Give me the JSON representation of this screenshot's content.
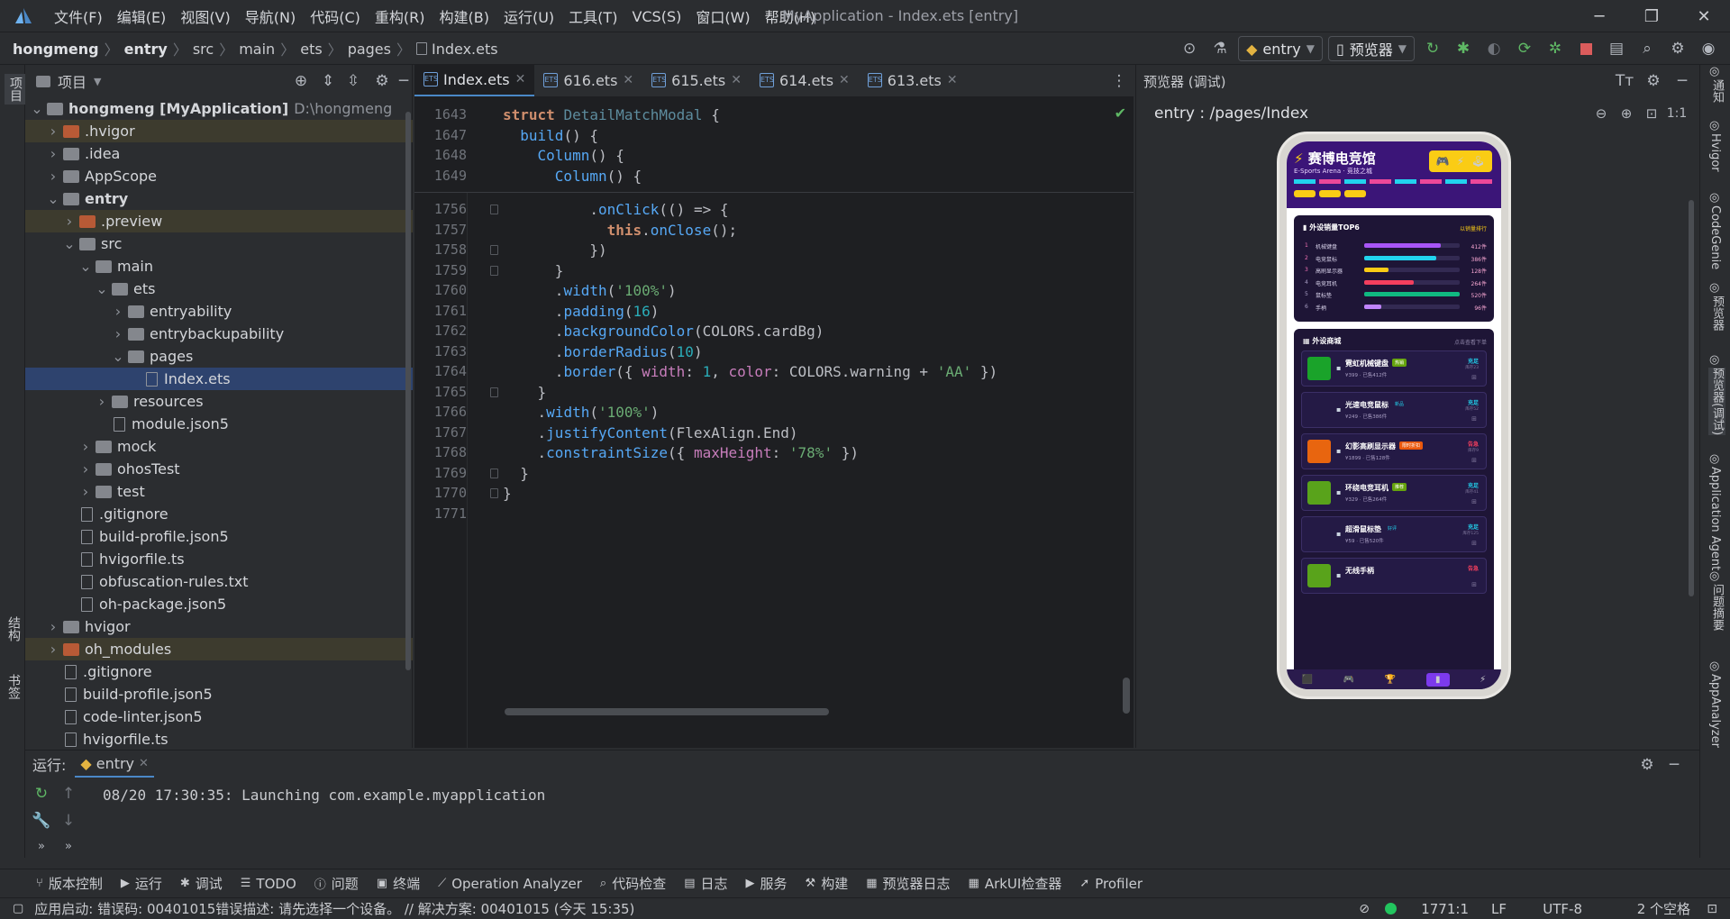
{
  "app": {
    "window_title": "MyApplication - Index.ets [entry]"
  },
  "menu": [
    "文件(F)",
    "编辑(E)",
    "视图(V)",
    "导航(N)",
    "代码(C)",
    "重构(R)",
    "构建(B)",
    "运行(U)",
    "工具(T)",
    "VCS(S)",
    "窗口(W)",
    "帮助(H)"
  ],
  "breadcrumb": [
    "hongmeng",
    "entry",
    "src",
    "main",
    "ets",
    "pages",
    "Index.ets"
  ],
  "toolbar": {
    "run_config": "entry",
    "device": "预览器"
  },
  "project": {
    "title": "项目",
    "tree": [
      {
        "label": "hongmeng [MyApplication]",
        "extra": "D:\\hongmeng",
        "indent": 0,
        "arrow": "v",
        "icon": "fold",
        "bold": true
      },
      {
        "label": ".hvigor",
        "indent": 1,
        "arrow": ">",
        "icon": "ofold",
        "hl": true
      },
      {
        "label": ".idea",
        "indent": 1,
        "arrow": ">",
        "icon": "fold"
      },
      {
        "label": "AppScope",
        "indent": 1,
        "arrow": ">",
        "icon": "fold"
      },
      {
        "label": "entry",
        "indent": 1,
        "arrow": "v",
        "icon": "fold",
        "bold": true
      },
      {
        "label": ".preview",
        "indent": 2,
        "arrow": ">",
        "icon": "ofold",
        "hl": true
      },
      {
        "label": "src",
        "indent": 2,
        "arrow": "v",
        "icon": "fold"
      },
      {
        "label": "main",
        "indent": 3,
        "arrow": "v",
        "icon": "fold"
      },
      {
        "label": "ets",
        "indent": 4,
        "arrow": "v",
        "icon": "fold"
      },
      {
        "label": "entryability",
        "indent": 5,
        "arrow": ">",
        "icon": "fold"
      },
      {
        "label": "entrybackupability",
        "indent": 5,
        "arrow": ">",
        "icon": "fold"
      },
      {
        "label": "pages",
        "indent": 5,
        "arrow": "v",
        "icon": "fold"
      },
      {
        "label": "Index.ets",
        "indent": 6,
        "arrow": "",
        "icon": "file",
        "sel": true
      },
      {
        "label": "resources",
        "indent": 4,
        "arrow": ">",
        "icon": "fold"
      },
      {
        "label": "module.json5",
        "indent": 4,
        "arrow": "",
        "icon": "file"
      },
      {
        "label": "mock",
        "indent": 3,
        "arrow": ">",
        "icon": "fold"
      },
      {
        "label": "ohosTest",
        "indent": 3,
        "arrow": ">",
        "icon": "fold"
      },
      {
        "label": "test",
        "indent": 3,
        "arrow": ">",
        "icon": "fold"
      },
      {
        "label": ".gitignore",
        "indent": 2,
        "arrow": "",
        "icon": "file"
      },
      {
        "label": "build-profile.json5",
        "indent": 2,
        "arrow": "",
        "icon": "file"
      },
      {
        "label": "hvigorfile.ts",
        "indent": 2,
        "arrow": "",
        "icon": "file"
      },
      {
        "label": "obfuscation-rules.txt",
        "indent": 2,
        "arrow": "",
        "icon": "file"
      },
      {
        "label": "oh-package.json5",
        "indent": 2,
        "arrow": "",
        "icon": "file"
      },
      {
        "label": "hvigor",
        "indent": 1,
        "arrow": ">",
        "icon": "fold"
      },
      {
        "label": "oh_modules",
        "indent": 1,
        "arrow": ">",
        "icon": "ofold",
        "hl": true
      },
      {
        "label": ".gitignore",
        "indent": 1,
        "arrow": "",
        "icon": "file"
      },
      {
        "label": "build-profile.json5",
        "indent": 1,
        "arrow": "",
        "icon": "file"
      },
      {
        "label": "code-linter.json5",
        "indent": 1,
        "arrow": "",
        "icon": "file"
      },
      {
        "label": "hvigorfile.ts",
        "indent": 1,
        "arrow": "",
        "icon": "file"
      }
    ]
  },
  "tabs": [
    "Index.ets",
    "616.ets",
    "615.ets",
    "614.ets",
    "613.ets"
  ],
  "code": {
    "sticky": [
      {
        "n": "1643",
        "t": "struct DetailMatchModal {"
      },
      {
        "n": "1647",
        "t": "  build() {"
      },
      {
        "n": "1648",
        "t": "    Column() {"
      },
      {
        "n": "1649",
        "t": "      Column() {"
      }
    ],
    "lines": [
      {
        "n": "1756",
        "t": "          .onClick(() => {"
      },
      {
        "n": "1757",
        "t": "            this.onClose();"
      },
      {
        "n": "1758",
        "t": "          })"
      },
      {
        "n": "1759",
        "t": "      }"
      },
      {
        "n": "1760",
        "t": "      .width('100%')"
      },
      {
        "n": "1761",
        "t": "      .padding(16)"
      },
      {
        "n": "1762",
        "t": "      .backgroundColor(COLORS.cardBg)"
      },
      {
        "n": "1763",
        "t": "      .borderRadius(10)"
      },
      {
        "n": "1764",
        "t": "      .border({ width: 1, color: COLORS.warning + 'AA' })"
      },
      {
        "n": "1765",
        "t": "    }"
      },
      {
        "n": "1766",
        "t": "    .width('100%')"
      },
      {
        "n": "1767",
        "t": "    .justifyContent(FlexAlign.End)"
      },
      {
        "n": "1768",
        "t": "    .constraintSize({ maxHeight: '78%' })"
      },
      {
        "n": "1769",
        "t": "  }"
      },
      {
        "n": "1770",
        "t": "}"
      },
      {
        "n": "1771",
        "t": ""
      }
    ]
  },
  "preview": {
    "title": "预览器 (调试)",
    "path": "entry : /pages/Index",
    "app": {
      "header_title": "赛博电竞馆",
      "header_sub": "E-Sports Arena · 竞技之城",
      "top_card": {
        "title": "外设销量TOP6",
        "right": "以销量排行",
        "rows": [
          {
            "rank": "1",
            "name": "机械键盘",
            "value": "412件",
            "pct": 0.8,
            "color": "#a855f7"
          },
          {
            "rank": "2",
            "name": "电竞鼠标",
            "value": "386件",
            "pct": 0.75,
            "color": "#22d3ee"
          },
          {
            "rank": "3",
            "name": "高刷显示器",
            "value": "128件",
            "pct": 0.25,
            "color": "#facc15"
          },
          {
            "rank": "4",
            "name": "电竞耳机",
            "value": "264件",
            "pct": 0.52,
            "color": "#f43f5e"
          },
          {
            "rank": "5",
            "name": "鼠标垫",
            "value": "520件",
            "pct": 1.0,
            "color": "#10b981"
          },
          {
            "rank": "6",
            "name": "手柄",
            "value": "96件",
            "pct": 0.18,
            "color": "#c084fc"
          }
        ]
      },
      "shop_card": {
        "title": "外设商城",
        "right": "点击查看下单",
        "items": [
          {
            "name": "霓虹机械键盘",
            "tag": "热销",
            "price": "¥399 · 已售412件",
            "status": "充足",
            "stock": "库存23",
            "thumb": "#1aa32a",
            "tagc": "#65a30d",
            "sc": "#22d3ee"
          },
          {
            "name": "光速电竞鼠标",
            "tag": "新品",
            "price": "¥249 · 已售386件",
            "status": "充足",
            "stock": "库存52",
            "thumb": "",
            "tagc": "",
            "sc": "#22d3ee"
          },
          {
            "name": "幻影高刷显示器",
            "tag": "限时折扣",
            "price": "¥1899 · 已售128件",
            "status": "告急",
            "stock": "库存9",
            "thumb": "#e8650f",
            "tagc": "#ea580c",
            "sc": "#f43f5e"
          },
          {
            "name": "环绕电竞耳机",
            "tag": "推荐",
            "price": "¥329 · 已售264件",
            "status": "充足",
            "stock": "库存41",
            "thumb": "#59a31b",
            "tagc": "#65a30d",
            "sc": "#22d3ee"
          },
          {
            "name": "超滑鼠标垫",
            "tag": "好评",
            "price": "¥59 · 已售520件",
            "status": "充足",
            "stock": "库存125",
            "thumb": "",
            "tagc": "",
            "sc": "#22d3ee"
          },
          {
            "name": "无线手柄",
            "tag": "",
            "price": "",
            "status": "告急",
            "stock": "",
            "thumb": "#59a31b",
            "tagc": "#65a30d",
            "sc": "#f43f5e"
          }
        ]
      }
    }
  },
  "right_strip": [
    "通知",
    "Hvigor",
    "CodeGenie",
    "预览器",
    "预览器(调试)",
    "Application Agent",
    "问题摘要",
    "AppAnalyzer"
  ],
  "run": {
    "label": "运行:",
    "config": "entry",
    "console": "08/20 17:30:35: Launching com.example.myapplication"
  },
  "tool_windows": [
    "版本控制",
    "运行",
    "调试",
    "TODO",
    "问题",
    "终端",
    "Operation Analyzer",
    "代码检查",
    "日志",
    "服务",
    "构建",
    "预览器日志",
    "ArkUI检查器",
    "Profiler"
  ],
  "status": {
    "message": "应用启动: 错误码: 00401015错误描述: 请先选择一个设备。 // 解决方案: 00401015 (今天 15:35)",
    "position": "1771:1",
    "line_sep": "LF",
    "encoding": "UTF-8",
    "indent": "2 个空格"
  },
  "left_strip": [
    "项目",
    "结构",
    "书签"
  ]
}
